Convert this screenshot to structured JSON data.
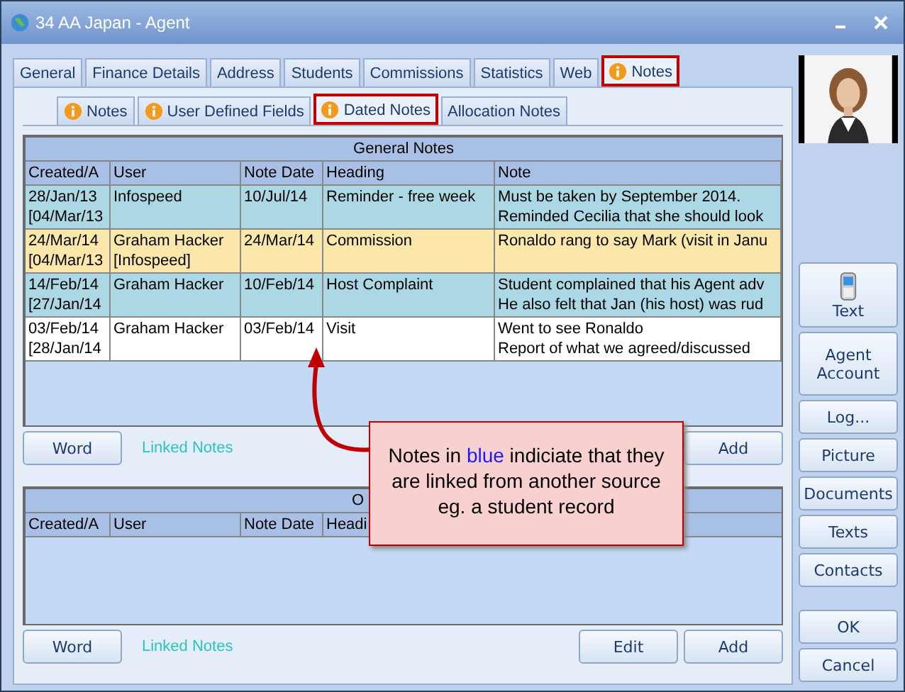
{
  "window": {
    "title": "34 AA Japan - Agent"
  },
  "tabs": [
    {
      "label": "General",
      "selected": false,
      "info": false,
      "outlined": false
    },
    {
      "label": "Finance Details",
      "selected": false,
      "info": false,
      "outlined": false
    },
    {
      "label": "Address",
      "selected": false,
      "info": false,
      "outlined": false
    },
    {
      "label": "Students",
      "selected": false,
      "info": false,
      "outlined": false
    },
    {
      "label": "Commissions",
      "selected": false,
      "info": false,
      "outlined": false
    },
    {
      "label": "Statistics",
      "selected": false,
      "info": false,
      "outlined": false
    },
    {
      "label": "Web",
      "selected": false,
      "info": false,
      "outlined": false
    },
    {
      "label": "Notes",
      "selected": true,
      "info": true,
      "outlined": true
    }
  ],
  "subtabs": [
    {
      "label": "Notes",
      "selected": false,
      "info": true,
      "outlined": false
    },
    {
      "label": "User Defined Fields",
      "selected": false,
      "info": true,
      "outlined": false
    },
    {
      "label": "Dated Notes",
      "selected": true,
      "info": true,
      "outlined": true
    },
    {
      "label": "Allocation Notes",
      "selected": false,
      "info": false,
      "outlined": false
    }
  ],
  "general_notes": {
    "title": "General Notes",
    "columns": [
      "Created/A",
      "User",
      "Note Date",
      "Heading",
      "Note"
    ],
    "rows": [
      {
        "color": "#acd8e6",
        "cells": [
          "28/Jan/13\n[04/Mar/13",
          "Infospeed",
          "10/Jul/14",
          "Reminder - free week",
          "Must be taken by September 2014.\nReminded Cecilia that she should look"
        ]
      },
      {
        "color": "#fbe7a9",
        "cells": [
          "24/Mar/14\n[04/Mar/13",
          "Graham Hacker\n[Infospeed]",
          "24/Mar/14",
          "Commission",
          "Ronaldo rang to say Mark (visit in Janu"
        ]
      },
      {
        "color": "#acd8e6",
        "cells": [
          "14/Feb/14\n[27/Jan/14",
          "Graham Hacker",
          "10/Feb/14",
          "Host Complaint",
          "Student complained that his Agent adv\nHe also felt that Jan (his host) was rud"
        ]
      },
      {
        "color": "#ffffff",
        "cells": [
          "03/Feb/14\n[28/Jan/14",
          "Graham Hacker",
          "03/Feb/14",
          "Visit",
          "Went to see Ronaldo\nReport of what we agreed/discussed"
        ]
      }
    ],
    "buttons": [
      {
        "kind": "left",
        "label": "Word"
      },
      {
        "kind": "link",
        "label": "Linked Notes"
      },
      {
        "kind": "right",
        "label": "Add"
      }
    ]
  },
  "other_notes": {
    "title": "O",
    "columns": [
      "Created/A",
      "User",
      "Note Date",
      "Headi"
    ],
    "buttons": [
      {
        "kind": "left",
        "label": "Word"
      },
      {
        "kind": "link",
        "label": "Linked Notes"
      },
      {
        "kind": "right",
        "label": "Edit"
      },
      {
        "kind": "right",
        "label": "Add"
      }
    ]
  },
  "side_buttons": [
    {
      "kind": "phone",
      "label": "Text"
    },
    {
      "kind": "plain",
      "label": "Agent\nAccount"
    },
    {
      "kind": "plain",
      "label": "Log..."
    },
    {
      "kind": "plain",
      "label": "Picture"
    },
    {
      "kind": "plain",
      "label": "Documents"
    },
    {
      "kind": "plain",
      "label": "Texts"
    },
    {
      "kind": "plain",
      "label": "Contacts"
    },
    {
      "kind": "gap",
      "label": "OK"
    },
    {
      "kind": "plain",
      "label": "Cancel"
    }
  ],
  "callout": {
    "parts": [
      {
        "text": "Notes in "
      },
      {
        "text": "blue",
        "color": "#1a1aff"
      },
      {
        "text": " indiciate that they are linked from another source eg. a student record"
      }
    ]
  }
}
